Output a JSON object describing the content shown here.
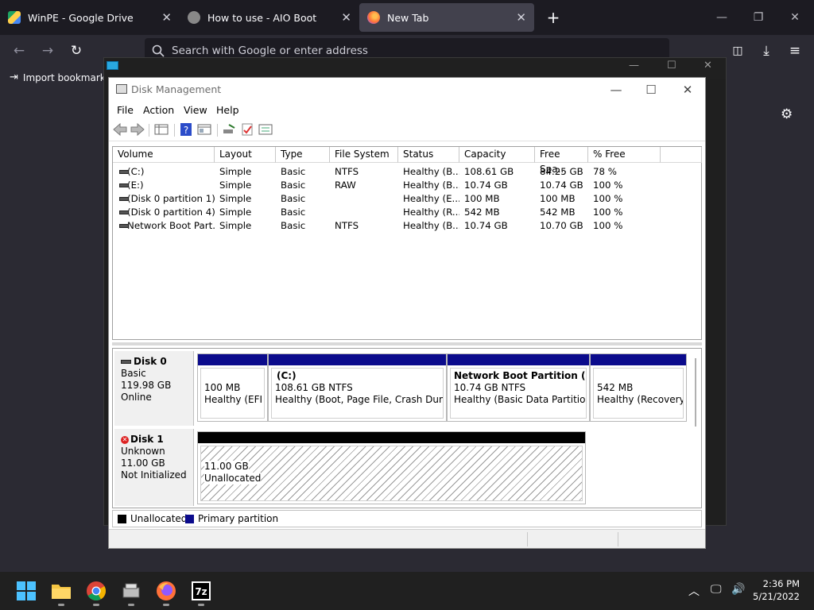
{
  "browser": {
    "tabs": [
      {
        "label": "WinPE - Google Drive",
        "icon": "google-drive-icon"
      },
      {
        "label": "How to use - AIO Boot",
        "icon": "aio-boot-icon"
      },
      {
        "label": "New Tab",
        "icon": "firefox-icon"
      }
    ],
    "url_placeholder": "Search with Google or enter address",
    "bookmarks_label": "Import bookmarks..."
  },
  "dm": {
    "title": "Disk Management",
    "menus": [
      "File",
      "Action",
      "View",
      "Help"
    ],
    "columns": [
      "Volume",
      "Layout",
      "Type",
      "File System",
      "Status",
      "Capacity",
      "Free Spa...",
      "% Free"
    ],
    "volumes": [
      [
        "(C:)",
        "Simple",
        "Basic",
        "NTFS",
        "Healthy (B...",
        "108.61 GB",
        "84.25 GB",
        "78 %"
      ],
      [
        "(E:)",
        "Simple",
        "Basic",
        "RAW",
        "Healthy (B...",
        "10.74 GB",
        "10.74 GB",
        "100 %"
      ],
      [
        "(Disk 0 partition 1)",
        "Simple",
        "Basic",
        "",
        "Healthy (E...",
        "100 MB",
        "100 MB",
        "100 %"
      ],
      [
        "(Disk 0 partition 4)",
        "Simple",
        "Basic",
        "",
        "Healthy (R...",
        "542 MB",
        "542 MB",
        "100 %"
      ],
      [
        "Network Boot Part...",
        "Simple",
        "Basic",
        "NTFS",
        "Healthy (B...",
        "10.74 GB",
        "10.70 GB",
        "100 %"
      ]
    ],
    "disk0": {
      "name": "Disk 0",
      "type": "Basic",
      "size": "119.98 GB",
      "state": "Online",
      "partitions": [
        {
          "name": "",
          "size": "100 MB",
          "status": "Healthy (EFI Sy"
        },
        {
          "name": "(C:)",
          "size": "108.61 GB NTFS",
          "status": "Healthy (Boot, Page File, Crash Dump, B"
        },
        {
          "name": "Network Boot Partition  (E:)",
          "size": "10.74 GB NTFS",
          "status": "Healthy (Basic Data Partition)"
        },
        {
          "name": "",
          "size": "542 MB",
          "status": "Healthy (Recovery P"
        }
      ]
    },
    "disk1": {
      "name": "Disk 1",
      "type": "Unknown",
      "size": "11.00 GB",
      "state": "Not Initialized",
      "unalloc_size": "11.00 GB",
      "unalloc_label": "Unallocated"
    },
    "legend": {
      "unallocated": "Unallocated",
      "primary": "Primary partition"
    }
  },
  "taskbar": {
    "time": "2:36 PM",
    "date": "5/21/2022"
  },
  "colors": {
    "primary": "#0b0b8c",
    "unallocated": "#000000",
    "browser_bg": "#2b2a33"
  }
}
